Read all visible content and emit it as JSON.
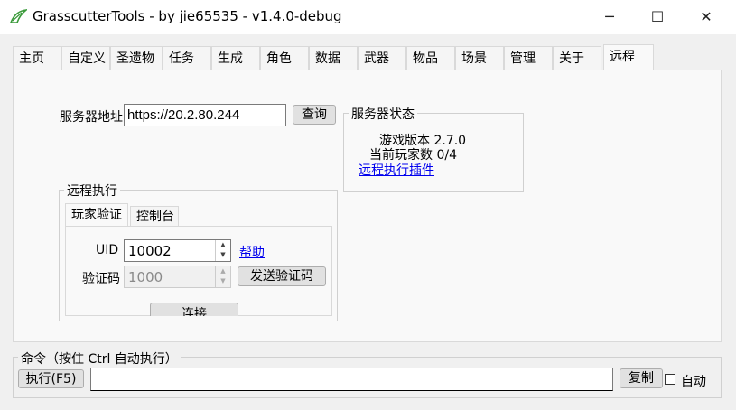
{
  "window": {
    "title": "GrasscutterTools  - by jie65535  - v1.4.0-debug",
    "minimize_icon": "─",
    "maximize_icon": "☐",
    "close_icon": "✕"
  },
  "tabs": [
    {
      "label": "主页"
    },
    {
      "label": "自定义"
    },
    {
      "label": "圣遗物"
    },
    {
      "label": "任务"
    },
    {
      "label": "生成"
    },
    {
      "label": "角色"
    },
    {
      "label": "数据"
    },
    {
      "label": "武器"
    },
    {
      "label": "物品"
    },
    {
      "label": "场景"
    },
    {
      "label": "管理"
    },
    {
      "label": "关于"
    },
    {
      "label": "远程"
    }
  ],
  "active_tab": "远程",
  "remote": {
    "server_address_label": "服务器地址",
    "server_address_value": "https://20.2.80.244",
    "query_button": "查询",
    "status_group": {
      "title": "服务器状态",
      "game_version": "游戏版本 2.7.0",
      "players": "当前玩家数 0/4",
      "plugin_link": "远程执行插件"
    },
    "exec_group": {
      "title": "远程执行",
      "subtabs": [
        {
          "label": "玩家验证"
        },
        {
          "label": "控制台"
        }
      ],
      "uid_label": "UID",
      "uid_value": "10002",
      "help_link": "帮助",
      "code_label": "验证码",
      "code_value": "1000",
      "send_code_button": "发送验证码",
      "connect_button": "连接"
    }
  },
  "command": {
    "label": "命令（按住 Ctrl 自动执行）",
    "execute_button": "执行(F5)",
    "input_value": "",
    "copy_button": "复制",
    "auto_label": "自动",
    "auto_checked": false
  },
  "colors": {
    "link": "#0000ee",
    "window_bg": "#f0f0f0",
    "tabpage_bg": "#f9f9f9"
  }
}
